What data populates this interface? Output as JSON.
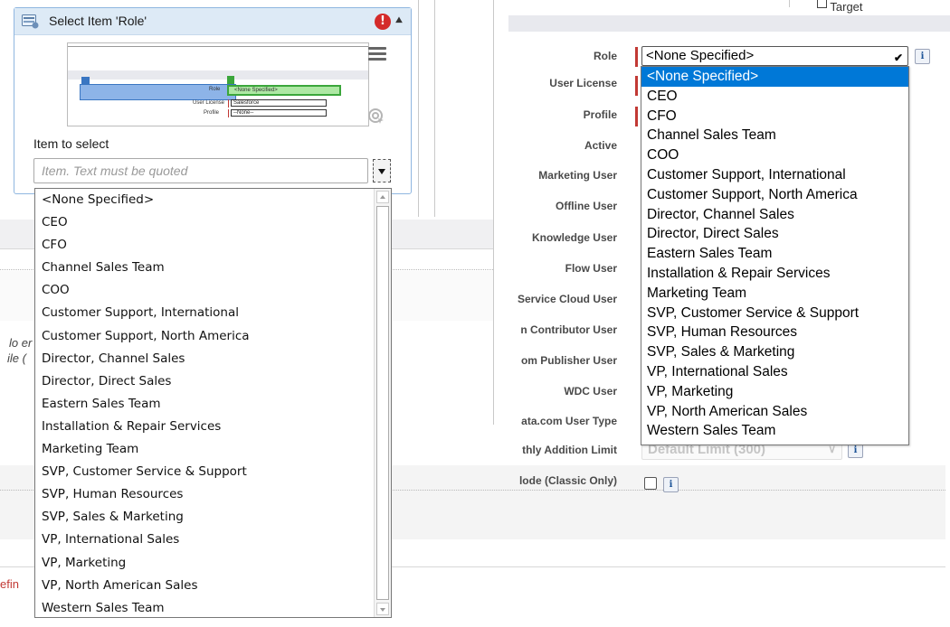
{
  "step": {
    "title": "Select Item 'Role'",
    "field_caption": "Item to select",
    "item_placeholder": "Item. Text must be quoted"
  },
  "thumbnail": {
    "role_label": "Role",
    "role_value": "<None Specified>",
    "user_license_label": "User License",
    "user_license_value": "Salesforce",
    "profile_label": "Profile",
    "profile_value": "--None--"
  },
  "item_options": [
    "<None Specified>",
    "CEO",
    "CFO",
    "Channel Sales Team",
    "COO",
    "Customer Support, International",
    "Customer Support, North America",
    "Director, Channel Sales",
    "Director, Direct Sales",
    "Eastern Sales Team",
    "Installation & Repair Services",
    "Marketing Team",
    "SVP, Customer Service & Support",
    "SVP, Human Resources",
    "SVP, Sales & Marketing",
    "VP, International Sales",
    "VP, Marketing",
    "VP, North American Sales",
    "Western Sales Team"
  ],
  "background": {
    "target_label": "Target",
    "left_fragment_1": "lo er",
    "left_fragment_2": "ile (",
    "error_fragment": "efin",
    "info_glyph": "i"
  },
  "form": {
    "labels": {
      "role": "Role",
      "user_license": "User License",
      "profile": "Profile",
      "active": "Active",
      "marketing_user": "Marketing User",
      "offline_user": "Offline User",
      "knowledge_user": "Knowledge User",
      "flow_user": "Flow User",
      "service_cloud_user": "Service Cloud User",
      "contributor_user": "n Contributor User",
      "publisher_user": "om Publisher User",
      "wdc_user": "WDC User",
      "datacom_user_type": "ata.com User Type",
      "monthly_addition_limit": "thly Addition Limit",
      "mode_classic_only": "lode (Classic Only)"
    },
    "role_select_value": "<None Specified>",
    "monthly_limit_value": "Default Limit (300)",
    "role_options": [
      "<None Specified>",
      "CEO",
      "CFO",
      "Channel Sales Team",
      "COO",
      "Customer Support, International",
      "Customer Support, North America",
      "Director, Channel Sales",
      "Director, Direct Sales",
      "Eastern Sales Team",
      "Installation & Repair Services",
      "Marketing Team",
      "SVP, Customer Service & Support",
      "SVP, Human Resources",
      "SVP, Sales & Marketing",
      "VP, International Sales",
      "VP, Marketing",
      "VP, North American Sales",
      "Western Sales Team"
    ],
    "selected_role_index": 0
  },
  "colors": {
    "selection": "#0078d7",
    "required": "#c23934",
    "card_border": "#8fb6e0",
    "card_header": "#ddeaf6",
    "error_icon": "#d42a2a"
  }
}
